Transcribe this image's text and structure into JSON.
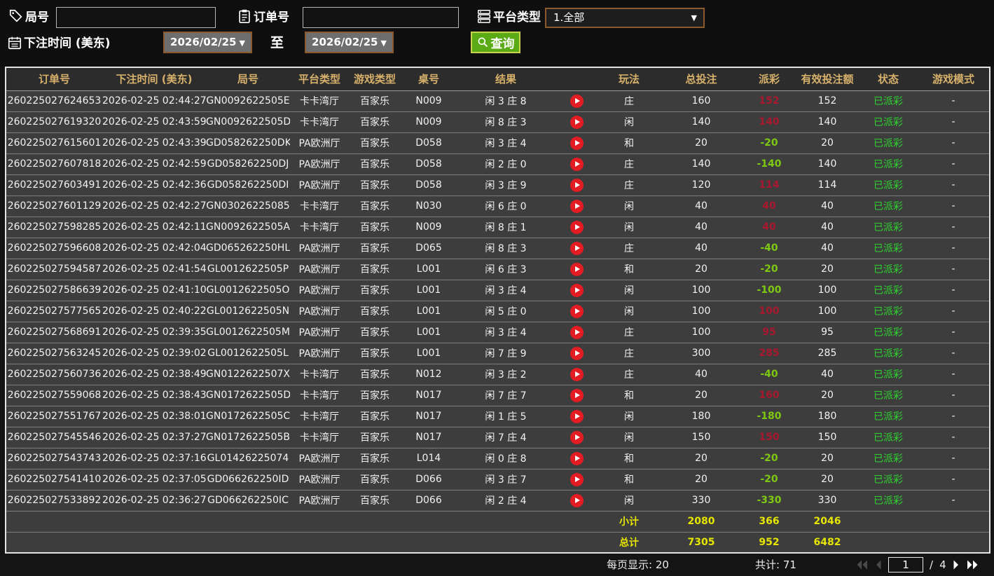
{
  "filters": {
    "round_label": "局号",
    "round_value": "",
    "order_label": "订单号",
    "order_value": "",
    "platform_label": "平台类型",
    "platform_value": "1.全部",
    "bet_time_label": "下注时间 (美东)",
    "date_from": "2026/02/25",
    "date_to": "2026/02/25",
    "to_label": "至",
    "query_label": "查询"
  },
  "table": {
    "headers": [
      "订单号",
      "下注时间 (美东)",
      "局号",
      "平台类型",
      "游戏类型",
      "桌号",
      "结果",
      "",
      "玩法",
      "总投注",
      "派彩",
      "有效投注额",
      "状态",
      "游戏模式"
    ],
    "rows": [
      {
        "order": "260225027624653",
        "time": "2026-02-25 02:44:27",
        "round": "GN0092622505E",
        "platform": "卡卡湾厅",
        "game": "百家乐",
        "table": "N009",
        "result": "闲 3 庄 8",
        "method": "庄",
        "bet": "160",
        "payout": "152",
        "valid": "152",
        "status": "已派彩",
        "mode": "-"
      },
      {
        "order": "260225027619320",
        "time": "2026-02-25 02:43:59",
        "round": "GN0092622505D",
        "platform": "卡卡湾厅",
        "game": "百家乐",
        "table": "N009",
        "result": "闲 8 庄 3",
        "method": "闲",
        "bet": "140",
        "payout": "140",
        "valid": "140",
        "status": "已派彩",
        "mode": "-"
      },
      {
        "order": "260225027615601",
        "time": "2026-02-25 02:43:39",
        "round": "GD058262250DK",
        "platform": "PA欧洲厅",
        "game": "百家乐",
        "table": "D058",
        "result": "闲 3 庄 4",
        "method": "和",
        "bet": "20",
        "payout": "-20",
        "valid": "20",
        "status": "已派彩",
        "mode": "-"
      },
      {
        "order": "260225027607818",
        "time": "2026-02-25 02:42:59",
        "round": "GD058262250DJ",
        "platform": "PA欧洲厅",
        "game": "百家乐",
        "table": "D058",
        "result": "闲 2 庄 0",
        "method": "庄",
        "bet": "140",
        "payout": "-140",
        "valid": "140",
        "status": "已派彩",
        "mode": "-"
      },
      {
        "order": "260225027603491",
        "time": "2026-02-25 02:42:36",
        "round": "GD058262250DI",
        "platform": "PA欧洲厅",
        "game": "百家乐",
        "table": "D058",
        "result": "闲 3 庄 9",
        "method": "庄",
        "bet": "120",
        "payout": "114",
        "valid": "114",
        "status": "已派彩",
        "mode": "-"
      },
      {
        "order": "260225027601129",
        "time": "2026-02-25 02:42:27",
        "round": "GN03026225085",
        "platform": "卡卡湾厅",
        "game": "百家乐",
        "table": "N030",
        "result": "闲 6 庄 0",
        "method": "闲",
        "bet": "40",
        "payout": "40",
        "valid": "40",
        "status": "已派彩",
        "mode": "-"
      },
      {
        "order": "260225027598285",
        "time": "2026-02-25 02:42:11",
        "round": "GN0092622505A",
        "platform": "卡卡湾厅",
        "game": "百家乐",
        "table": "N009",
        "result": "闲 8 庄 1",
        "method": "闲",
        "bet": "40",
        "payout": "40",
        "valid": "40",
        "status": "已派彩",
        "mode": "-"
      },
      {
        "order": "260225027596608",
        "time": "2026-02-25 02:42:04",
        "round": "GD065262250HL",
        "platform": "PA欧洲厅",
        "game": "百家乐",
        "table": "D065",
        "result": "闲 8 庄 3",
        "method": "庄",
        "bet": "40",
        "payout": "-40",
        "valid": "40",
        "status": "已派彩",
        "mode": "-"
      },
      {
        "order": "260225027594587",
        "time": "2026-02-25 02:41:54",
        "round": "GL0012622505P",
        "platform": "PA欧洲厅",
        "game": "百家乐",
        "table": "L001",
        "result": "闲 6 庄 3",
        "method": "和",
        "bet": "20",
        "payout": "-20",
        "valid": "20",
        "status": "已派彩",
        "mode": "-"
      },
      {
        "order": "260225027586639",
        "time": "2026-02-25 02:41:10",
        "round": "GL0012622505O",
        "platform": "PA欧洲厅",
        "game": "百家乐",
        "table": "L001",
        "result": "闲 3 庄 4",
        "method": "闲",
        "bet": "100",
        "payout": "-100",
        "valid": "100",
        "status": "已派彩",
        "mode": "-"
      },
      {
        "order": "260225027577565",
        "time": "2026-02-25 02:40:22",
        "round": "GL0012622505N",
        "platform": "PA欧洲厅",
        "game": "百家乐",
        "table": "L001",
        "result": "闲 5 庄 0",
        "method": "闲",
        "bet": "100",
        "payout": "100",
        "valid": "100",
        "status": "已派彩",
        "mode": "-"
      },
      {
        "order": "260225027568691",
        "time": "2026-02-25 02:39:35",
        "round": "GL0012622505M",
        "platform": "PA欧洲厅",
        "game": "百家乐",
        "table": "L001",
        "result": "闲 3 庄 4",
        "method": "庄",
        "bet": "100",
        "payout": "95",
        "valid": "95",
        "status": "已派彩",
        "mode": "-"
      },
      {
        "order": "260225027563245",
        "time": "2026-02-25 02:39:02",
        "round": "GL0012622505L",
        "platform": "PA欧洲厅",
        "game": "百家乐",
        "table": "L001",
        "result": "闲 7 庄 9",
        "method": "庄",
        "bet": "300",
        "payout": "285",
        "valid": "285",
        "status": "已派彩",
        "mode": "-"
      },
      {
        "order": "260225027560736",
        "time": "2026-02-25 02:38:49",
        "round": "GN0122622507X",
        "platform": "卡卡湾厅",
        "game": "百家乐",
        "table": "N012",
        "result": "闲 3 庄 2",
        "method": "庄",
        "bet": "40",
        "payout": "-40",
        "valid": "40",
        "status": "已派彩",
        "mode": "-"
      },
      {
        "order": "260225027559068",
        "time": "2026-02-25 02:38:43",
        "round": "GN0172622505D",
        "platform": "卡卡湾厅",
        "game": "百家乐",
        "table": "N017",
        "result": "闲 7 庄 7",
        "method": "和",
        "bet": "20",
        "payout": "160",
        "valid": "20",
        "status": "已派彩",
        "mode": "-"
      },
      {
        "order": "260225027551767",
        "time": "2026-02-25 02:38:01",
        "round": "GN0172622505C",
        "platform": "卡卡湾厅",
        "game": "百家乐",
        "table": "N017",
        "result": "闲 1 庄 5",
        "method": "闲",
        "bet": "180",
        "payout": "-180",
        "valid": "180",
        "status": "已派彩",
        "mode": "-"
      },
      {
        "order": "260225027545546",
        "time": "2026-02-25 02:37:27",
        "round": "GN0172622505B",
        "platform": "卡卡湾厅",
        "game": "百家乐",
        "table": "N017",
        "result": "闲 7 庄 4",
        "method": "闲",
        "bet": "150",
        "payout": "150",
        "valid": "150",
        "status": "已派彩",
        "mode": "-"
      },
      {
        "order": "260225027543743",
        "time": "2026-02-25 02:37:16",
        "round": "GL01426225074",
        "platform": "PA欧洲厅",
        "game": "百家乐",
        "table": "L014",
        "result": "闲 0 庄 8",
        "method": "和",
        "bet": "20",
        "payout": "-20",
        "valid": "20",
        "status": "已派彩",
        "mode": "-"
      },
      {
        "order": "260225027541410",
        "time": "2026-02-25 02:37:05",
        "round": "GD066262250ID",
        "platform": "PA欧洲厅",
        "game": "百家乐",
        "table": "D066",
        "result": "闲 3 庄 7",
        "method": "和",
        "bet": "20",
        "payout": "-20",
        "valid": "20",
        "status": "已派彩",
        "mode": "-"
      },
      {
        "order": "260225027533892",
        "time": "2026-02-25 02:36:27",
        "round": "GD066262250IC",
        "platform": "PA欧洲厅",
        "game": "百家乐",
        "table": "D066",
        "result": "闲 2 庄 4",
        "method": "闲",
        "bet": "330",
        "payout": "-330",
        "valid": "330",
        "status": "已派彩",
        "mode": "-"
      }
    ],
    "subtotal": {
      "label": "小计",
      "bet": "2080",
      "payout": "366",
      "valid": "2046"
    },
    "total": {
      "label": "总计",
      "bet": "7305",
      "payout": "952",
      "valid": "6482"
    }
  },
  "footer": {
    "per_page_label": "每页显示: 20",
    "total_count_label": "共计: 71",
    "current_page": "1",
    "page_separator": "/",
    "total_pages": "4"
  },
  "colors": {
    "header_text_gold": "#d7b16b",
    "payout_win_red": "#a8182f",
    "payout_loss_green": "#7fc812",
    "status_green": "#2fd32f",
    "summary_yellow": "#e6e600",
    "query_button_green": "#5aab15",
    "control_border_brown": "#8a5a2c",
    "play_icon_red": "#e31c23",
    "row_background": "#3d3d3d"
  }
}
